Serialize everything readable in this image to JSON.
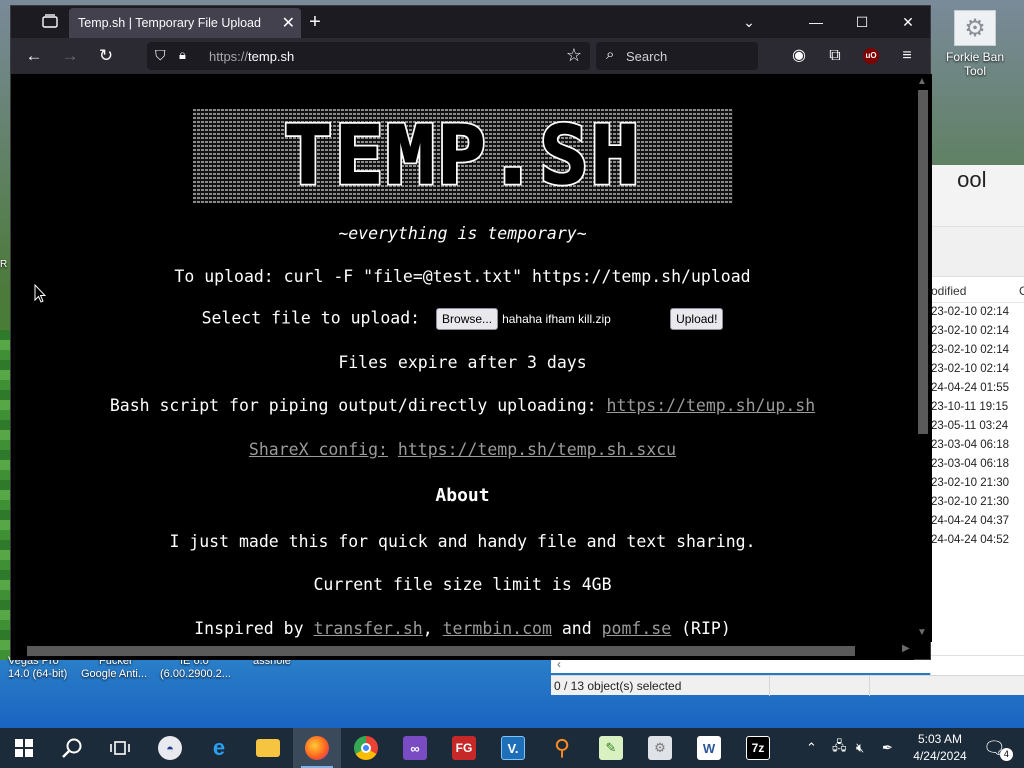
{
  "desktop": {
    "icons": [
      {
        "label": "Forkie Ban\nTool"
      }
    ],
    "partial_labels": [
      {
        "line1": "Vegas Pro",
        "line2": "14.0 (64-bit)"
      },
      {
        "line1": "Fucker",
        "line2": "Google Anti..."
      },
      {
        "line1": "IE 6.0",
        "line2": "(6.00.2900.2..."
      },
      {
        "line1": "asshole",
        "line2": ""
      }
    ],
    "edge_letter": "R"
  },
  "explorer": {
    "partial_title": " ool",
    "column_header": "odified",
    "column_header_2": "C",
    "rows": [
      "23-02-10 02:14",
      "23-02-10 02:14",
      "23-02-10 02:14",
      "23-02-10 02:14",
      "24-04-24 01:55",
      "23-10-11 19:15",
      "23-05-11 03:24",
      "23-03-04 06:18",
      "23-03-04 06:18",
      "23-02-10 21:30",
      "23-02-10 21:30",
      "24-04-24 04:37",
      "24-04-24 04:52"
    ],
    "status": "0 / 13 object(s) selected"
  },
  "browser": {
    "tab_title": "Temp.sh | Temporary File Upload",
    "url_scheme": "https://",
    "url_host": "temp.sh",
    "search_placeholder": "Search",
    "ublock_label": "uO"
  },
  "page": {
    "logo_text": "TEMP.SH",
    "tagline": "~everything is temporary~",
    "upload_instruction": "To upload: curl -F \"file=@test.txt\" https://temp.sh/upload",
    "select_label": "Select file to upload:",
    "browse_button": "Browse...",
    "selected_file": "hahaha ifham kill.zip",
    "upload_button": "Upload!",
    "expire_text": "Files expire after 3 days",
    "bash_label": "Bash script for piping output/directly uploading:",
    "bash_link": "https://temp.sh/up.sh",
    "sharex_label": "ShareX config:",
    "sharex_link": "https://temp.sh/temp.sh.sxcu",
    "about_heading": "About",
    "about_text": "I just made this for quick and handy file and text sharing.",
    "size_limit": "Current file size limit is 4GB",
    "inspired_prefix": "Inspired by",
    "inspired_link1": "transfer.sh",
    "inspired_sep": ",",
    "inspired_link2": "termbin.com",
    "inspired_and": "and",
    "inspired_link3": "pomf.se",
    "inspired_suffix": "(RIP)"
  },
  "taskbar": {
    "time": "5:03 AM",
    "date": "4/24/2024",
    "notification_count": "4",
    "apps": [
      "start",
      "search",
      "task-view",
      "obama",
      "internet-explorer",
      "file-explorer",
      "firefox",
      "chrome",
      "visual-studio",
      "fg",
      "v-app",
      "search-tool",
      "notepad-plus",
      "forkie",
      "word-doc",
      "7zip"
    ]
  }
}
